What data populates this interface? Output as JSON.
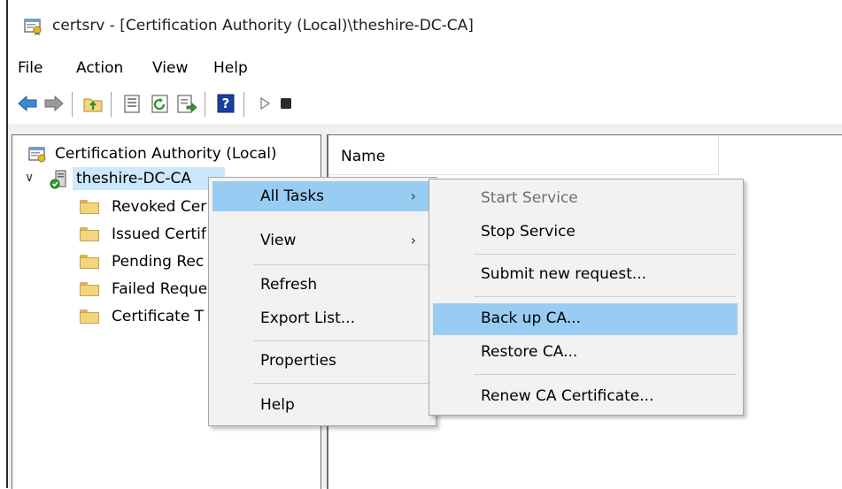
{
  "window": {
    "title": "certsrv - [Certification Authority (Local)\\theshire-DC-CA]"
  },
  "menubar": {
    "items": [
      "File",
      "Action",
      "View",
      "Help"
    ]
  },
  "toolbar": {
    "buttons": [
      "back-arrow-icon",
      "forward-arrow-icon",
      "up-folder-icon",
      "properties-icon",
      "refresh-icon",
      "export-list-icon",
      "help-icon",
      "play-icon",
      "stop-icon"
    ]
  },
  "tree": {
    "root": "Certification Authority (Local)",
    "ca": "theshire-DC-CA",
    "folders": [
      "Revoked Cer",
      "Issued Certif",
      "Pending Rec",
      "Failed Reque",
      "Certificate T"
    ]
  },
  "list": {
    "column_name": "Name"
  },
  "context_menu": {
    "items": [
      "All Tasks",
      "View",
      "Refresh",
      "Export List...",
      "Properties",
      "Help"
    ]
  },
  "submenu": {
    "items": [
      "Start Service",
      "Stop Service",
      "Submit new request...",
      "Back up CA...",
      "Restore CA...",
      "Renew CA Certificate..."
    ]
  },
  "colors": {
    "highlight": "#99ccf3",
    "selection": "#cce8ff",
    "menu_bg": "#f2f2f2",
    "disabled_text": "#6d6d6d"
  }
}
